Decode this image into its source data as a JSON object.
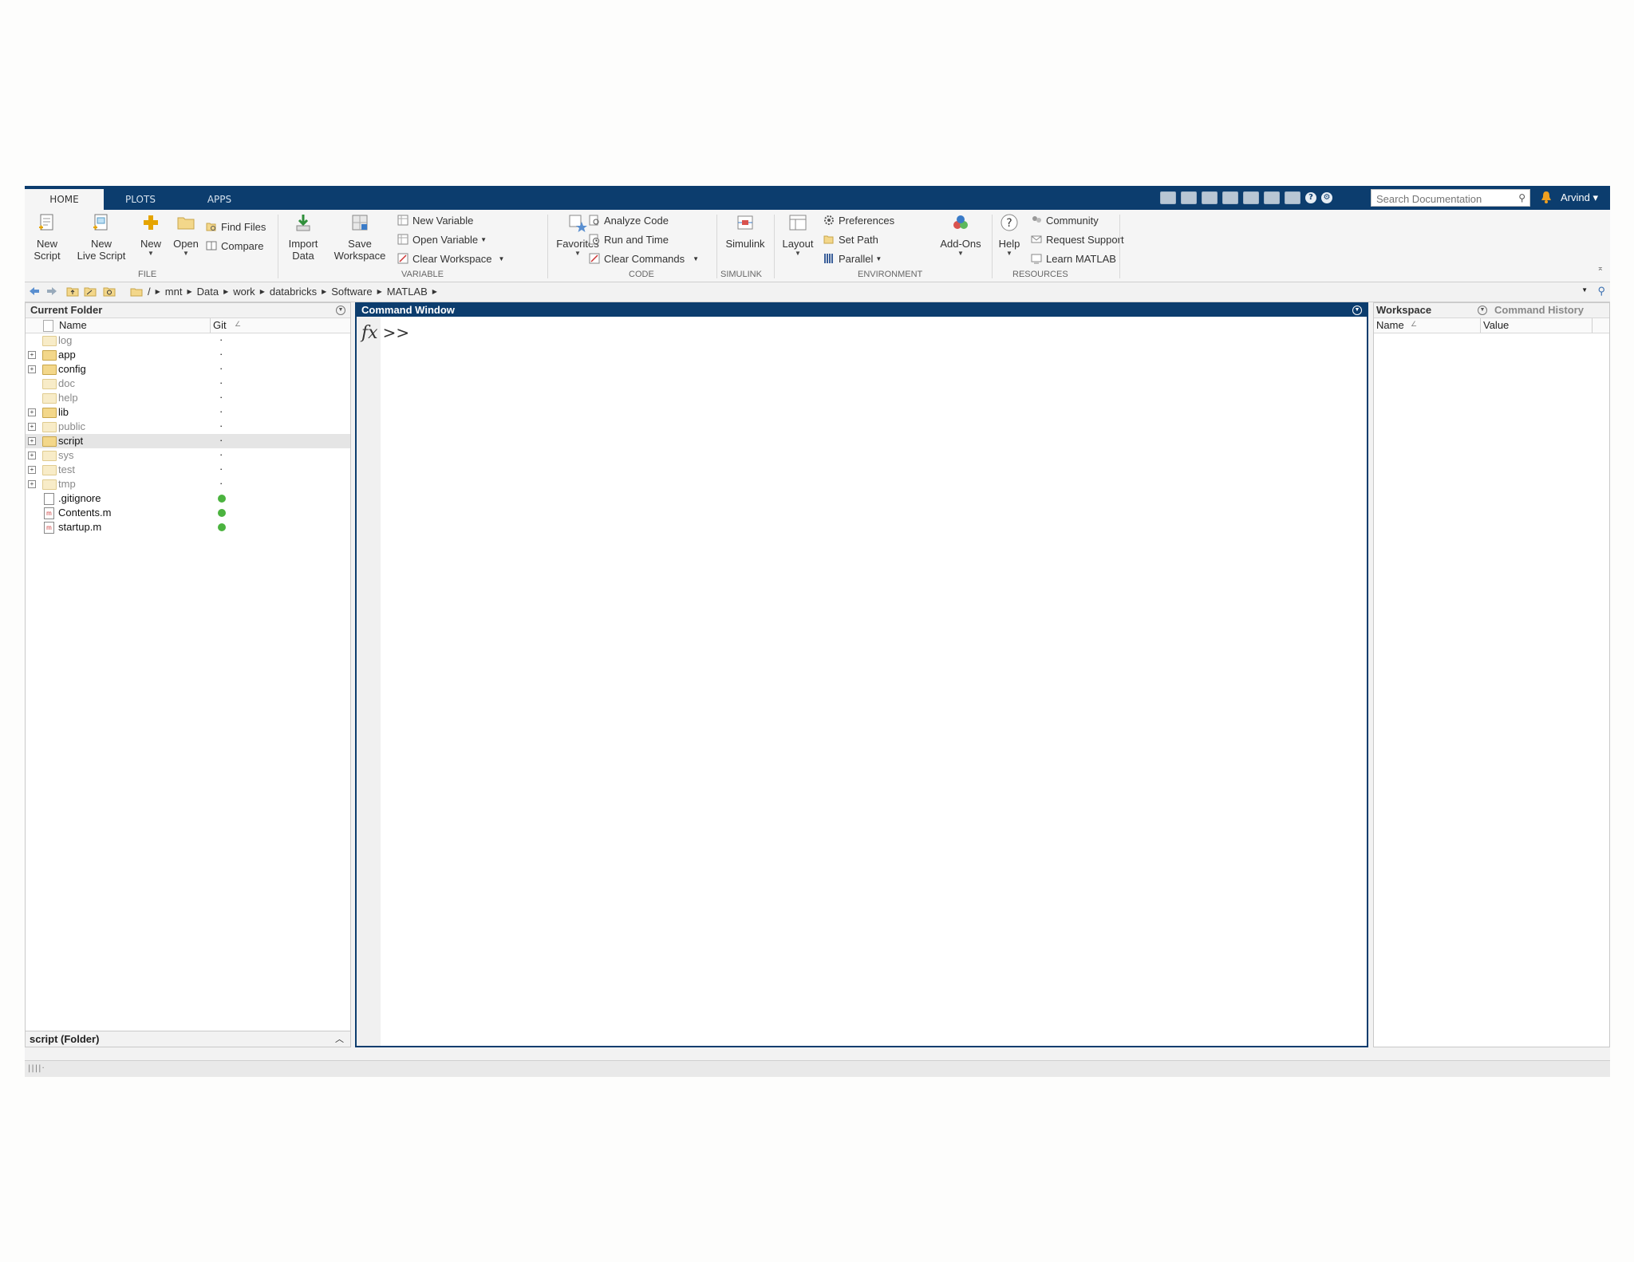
{
  "tabs": [
    "HOME",
    "PLOTS",
    "APPS"
  ],
  "search": {
    "placeholder": "Search Documentation"
  },
  "user": {
    "name": "Arvind"
  },
  "ribbon": {
    "file": {
      "label": "FILE",
      "new_script": [
        "New",
        "Script"
      ],
      "new_live_script": [
        "New",
        "Live Script"
      ],
      "new": "New",
      "open": "Open",
      "find_files": "Find Files",
      "compare": "Compare"
    },
    "variable": {
      "label": "VARIABLE",
      "import_data": [
        "Import",
        "Data"
      ],
      "save_workspace": [
        "Save",
        "Workspace"
      ],
      "new_variable": "New Variable",
      "open_variable": "Open Variable",
      "clear_workspace": "Clear Workspace"
    },
    "code": {
      "label": "CODE",
      "favorites": "Favorites",
      "analyze_code": "Analyze Code",
      "run_and_time": "Run and Time",
      "clear_commands": "Clear Commands"
    },
    "simulink": {
      "label": "SIMULINK",
      "simulink": "Simulink"
    },
    "environment": {
      "label": "ENVIRONMENT",
      "layout": "Layout",
      "preferences": "Preferences",
      "set_path": "Set Path",
      "parallel": "Parallel",
      "add_ons": "Add-Ons"
    },
    "resources": {
      "label": "RESOURCES",
      "help": "Help",
      "community": "Community",
      "request_support": "Request Support",
      "learn_matlab": "Learn MATLAB"
    }
  },
  "address": {
    "crumbs": [
      "/",
      "mnt",
      "Data",
      "work",
      "databricks",
      "Software",
      "MATLAB"
    ]
  },
  "current_folder": {
    "title": "Current Folder",
    "columns": {
      "name": "Name",
      "git": "Git"
    },
    "items": [
      {
        "name": "log",
        "type": "folder",
        "expand": false,
        "dim": true,
        "git": "·"
      },
      {
        "name": "app",
        "type": "folder",
        "expand": true,
        "dim": false,
        "git": "·"
      },
      {
        "name": "config",
        "type": "folder",
        "expand": true,
        "dim": false,
        "git": "·"
      },
      {
        "name": "doc",
        "type": "folder",
        "expand": false,
        "dim": true,
        "git": "·"
      },
      {
        "name": "help",
        "type": "folder",
        "expand": false,
        "dim": true,
        "git": "·"
      },
      {
        "name": "lib",
        "type": "folder",
        "expand": true,
        "dim": false,
        "git": "·"
      },
      {
        "name": "public",
        "type": "folder",
        "expand": true,
        "dim": true,
        "git": "·"
      },
      {
        "name": "script",
        "type": "folder",
        "expand": true,
        "dim": false,
        "git": "·",
        "selected": true
      },
      {
        "name": "sys",
        "type": "folder",
        "expand": true,
        "dim": true,
        "git": "·"
      },
      {
        "name": "test",
        "type": "folder",
        "expand": true,
        "dim": true,
        "git": "·"
      },
      {
        "name": "tmp",
        "type": "folder",
        "expand": true,
        "dim": true,
        "git": "·"
      },
      {
        "name": ".gitignore",
        "type": "file",
        "expand": false,
        "dim": false,
        "git": "dot"
      },
      {
        "name": "Contents.m",
        "type": "mfile",
        "expand": false,
        "dim": false,
        "git": "dot"
      },
      {
        "name": "startup.m",
        "type": "mfile",
        "expand": false,
        "dim": false,
        "git": "dot"
      }
    ],
    "footer": "script  (Folder)"
  },
  "command_window": {
    "title": "Command Window",
    "fx": "fx",
    "prompt": ">>"
  },
  "workspace": {
    "tab_workspace": "Workspace",
    "tab_history": "Command History",
    "columns": {
      "name": "Name",
      "value": "Value"
    }
  },
  "colors": {
    "titlebar": "#0c3d6e",
    "git_dot": "#4bb33f"
  }
}
